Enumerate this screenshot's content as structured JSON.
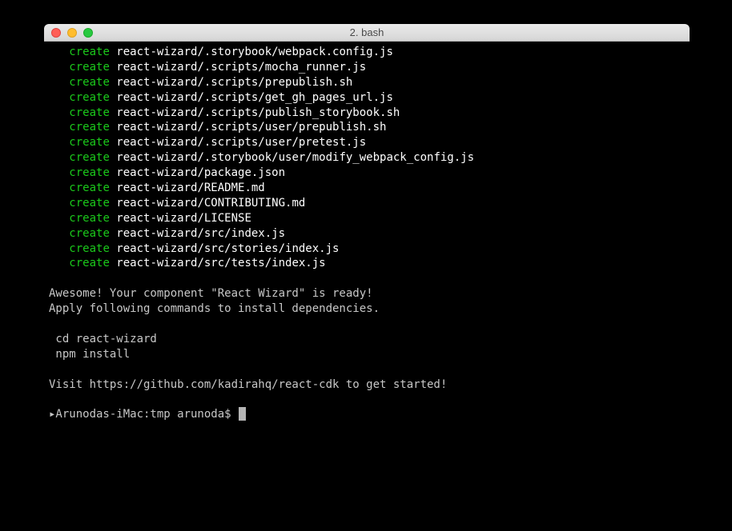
{
  "window": {
    "title": "2. bash"
  },
  "terminal": {
    "create_label": "create",
    "created_paths": [
      "react-wizard/.storybook/webpack.config.js",
      "react-wizard/.scripts/mocha_runner.js",
      "react-wizard/.scripts/prepublish.sh",
      "react-wizard/.scripts/get_gh_pages_url.js",
      "react-wizard/.scripts/publish_storybook.sh",
      "react-wizard/.scripts/user/prepublish.sh",
      "react-wizard/.scripts/user/pretest.js",
      "react-wizard/.storybook/user/modify_webpack_config.js",
      "react-wizard/package.json",
      "react-wizard/README.md",
      "react-wizard/CONTRIBUTING.md",
      "react-wizard/LICENSE",
      "react-wizard/src/index.js",
      "react-wizard/src/stories/index.js",
      "react-wizard/src/tests/index.js"
    ],
    "messages": {
      "ready": "Awesome! Your component \"React Wizard\" is ready!",
      "apply": "Apply following commands to install dependencies.",
      "cmd1": " cd react-wizard",
      "cmd2": " npm install",
      "visit": "Visit https://github.com/kadirahq/react-cdk to get started!"
    },
    "prompt": "▸Arunodas-iMac:tmp arunoda$ "
  }
}
